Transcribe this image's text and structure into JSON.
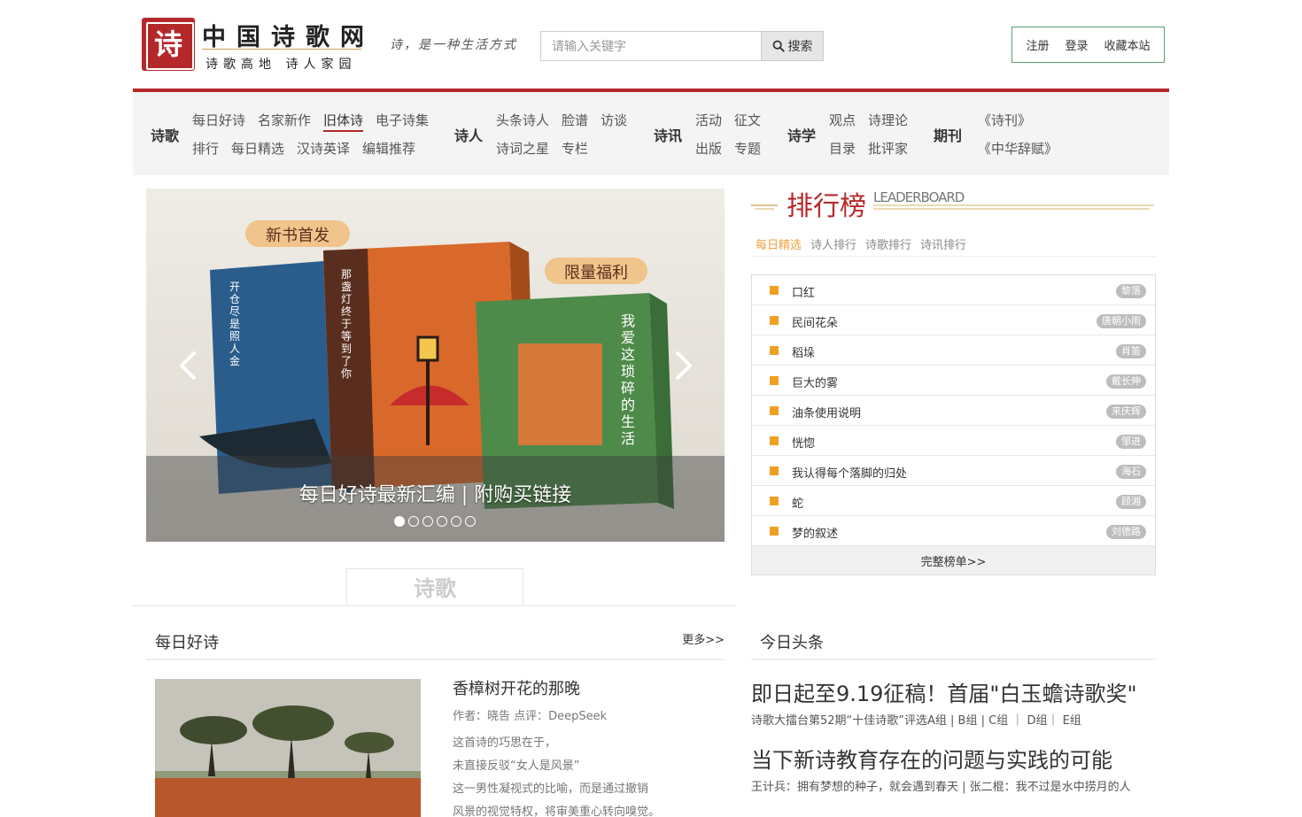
{
  "header": {
    "logo_char": "诗",
    "site_name": "中国诗歌网",
    "site_sub": "诗歌高地 诗人家园",
    "slogan": "诗，是一种生活方式",
    "search_placeholder": "请输入关键字",
    "search_label": "搜索",
    "register": "注册",
    "login": "登录",
    "bookmark": "收藏本站"
  },
  "nav": {
    "groups": [
      {
        "cat": "诗歌",
        "row1": [
          "每日好诗",
          "名家新作",
          "旧体诗",
          "电子诗集"
        ],
        "row2": [
          "排行",
          "每日精选",
          "汉诗英译",
          "编辑推荐"
        ]
      },
      {
        "cat": "诗人",
        "row1": [
          "头条诗人",
          "脸谱",
          "访谈"
        ],
        "row2": [
          "诗词之星",
          "专栏"
        ]
      },
      {
        "cat": "诗讯",
        "row1": [
          "活动",
          "征文"
        ],
        "row2": [
          "出版",
          "专题"
        ]
      },
      {
        "cat": "诗学",
        "row1": [
          "观点",
          "诗理论"
        ],
        "row2": [
          "目录",
          "批评家"
        ]
      },
      {
        "cat": "期刊",
        "row1": [
          "《诗刊》"
        ],
        "row2": [
          "《中华辞赋》"
        ]
      }
    ],
    "active": "旧体诗"
  },
  "carousel": {
    "caption": "每日好诗最新汇编 | 附购买链接",
    "badge_left": "新书首发",
    "badge_right": "限量福利",
    "book1_title": "开仓尽是照人金",
    "book2_title": "那盏灯终于等到了你",
    "book3_title": "我爱这琐碎的生活",
    "dot_count": 6,
    "active_dot": 0
  },
  "section_title": "诗歌",
  "leaderboard": {
    "title": "排行榜",
    "title_en": "LEADERBOARD",
    "tabs": [
      "每日精选",
      "诗人排行",
      "诗歌排行",
      "诗讯排行"
    ],
    "active_tab": 0,
    "items": [
      {
        "title": "口红",
        "author": "黎落"
      },
      {
        "title": "民间花朵",
        "author": "唐朝小雨"
      },
      {
        "title": "稻垛",
        "author": "肖笛"
      },
      {
        "title": "巨大的雾",
        "author": "戴长伸"
      },
      {
        "title": "油条使用说明",
        "author": "来庆辉"
      },
      {
        "title": "恍惚",
        "author": "邹进"
      },
      {
        "title": "我认得每个落脚的归处",
        "author": "海石"
      },
      {
        "title": "蛇",
        "author": "顾湘"
      },
      {
        "title": "梦的叙述",
        "author": "刘德路"
      }
    ],
    "more": "完整榜单>>"
  },
  "daily": {
    "title": "每日好诗",
    "more": "更多>>",
    "poem_title": "香樟树开花的那晚",
    "poem_meta": "作者：晓告 点评：DeepSeek",
    "lines": [
      "这首诗的巧思在于，",
      "未直接反驳“女人是风景”",
      "这一男性凝视式的比喻，而是通过撤销",
      "风景的视觉特权，将审美重心转向嗅觉。"
    ]
  },
  "news": {
    "title": "今日头条",
    "h1": "即日起至9.19征稿！首届\"白玉蟾诗歌奖\"",
    "s1": "诗歌大擂台第52期“十佳诗歌”评选A组 | B组 | C组 ｜ D组｜ E组",
    "h2": "当下新诗教育存在的问题与实践的可能",
    "s2": "王计兵：拥有梦想的种子，就会遇到春天 | 张二棍：我不过是水中捞月的人"
  },
  "colors": {
    "brand_red": "#b5282a",
    "accent_orange": "#f0a020",
    "border_green": "#5a9e6f"
  },
  "icons": [
    "search-icon",
    "chevron-left-icon",
    "chevron-right-icon"
  ]
}
